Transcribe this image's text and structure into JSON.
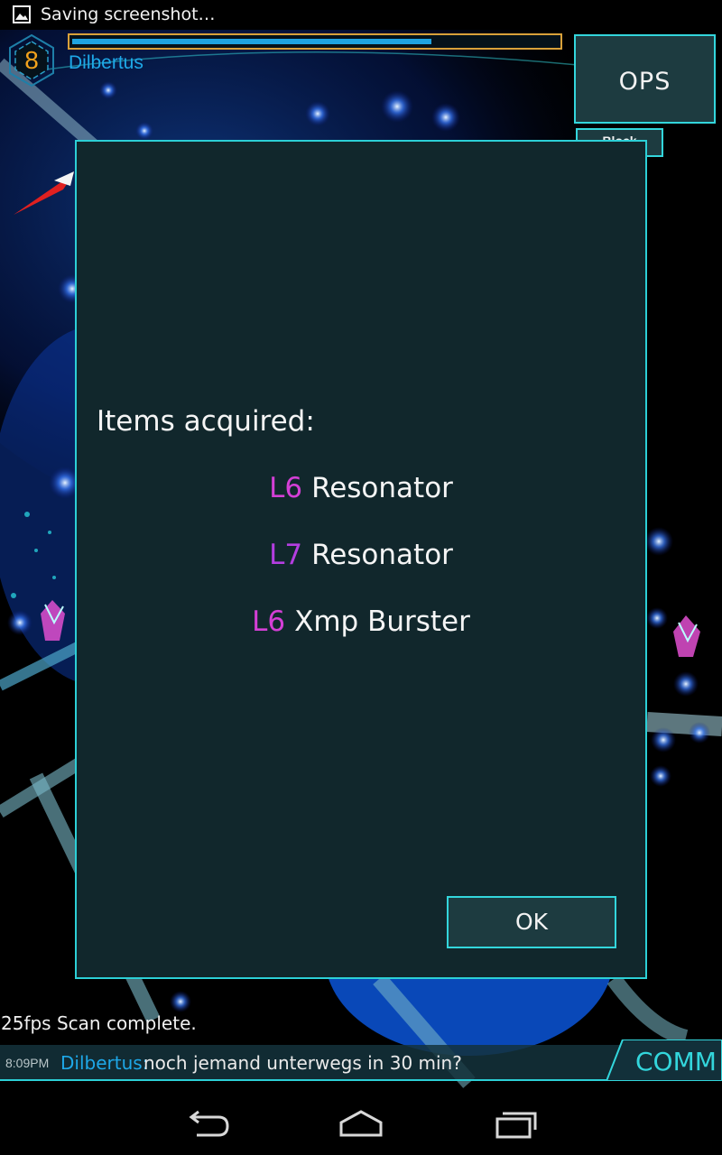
{
  "status_bar": {
    "notification": "Saving screenshot…",
    "notification_icon": "image-icon"
  },
  "player": {
    "level": "8",
    "name": "Dilbertus",
    "xp_progress": 0.74
  },
  "ops": {
    "label": "OPS",
    "block_label": "Block"
  },
  "dialog": {
    "title": "Items acquired:",
    "items": [
      {
        "level": "L6",
        "name": "Resonator",
        "level_color": "#d43fd6"
      },
      {
        "level": "L7",
        "name": "Resonator",
        "level_color": "#b43ee0"
      },
      {
        "level": "L6",
        "name": "Xmp Burster",
        "level_color": "#d43fd6"
      }
    ],
    "ok_label": "OK"
  },
  "hud": {
    "fps": "25fps",
    "status": "Scan complete."
  },
  "comm": {
    "time": "8:09PM",
    "sender": "Dilbertus:",
    "message": "noch jemand unterwegs in 30 min?",
    "button_label": "COMM"
  },
  "navbar": {
    "icons": [
      "back-icon",
      "home-icon",
      "recent-apps-icon"
    ]
  },
  "colors": {
    "accent": "#2ccfd6",
    "agent": "#1ea8e8",
    "level": "#f2a21c",
    "dialog_bg": "#11272c"
  }
}
